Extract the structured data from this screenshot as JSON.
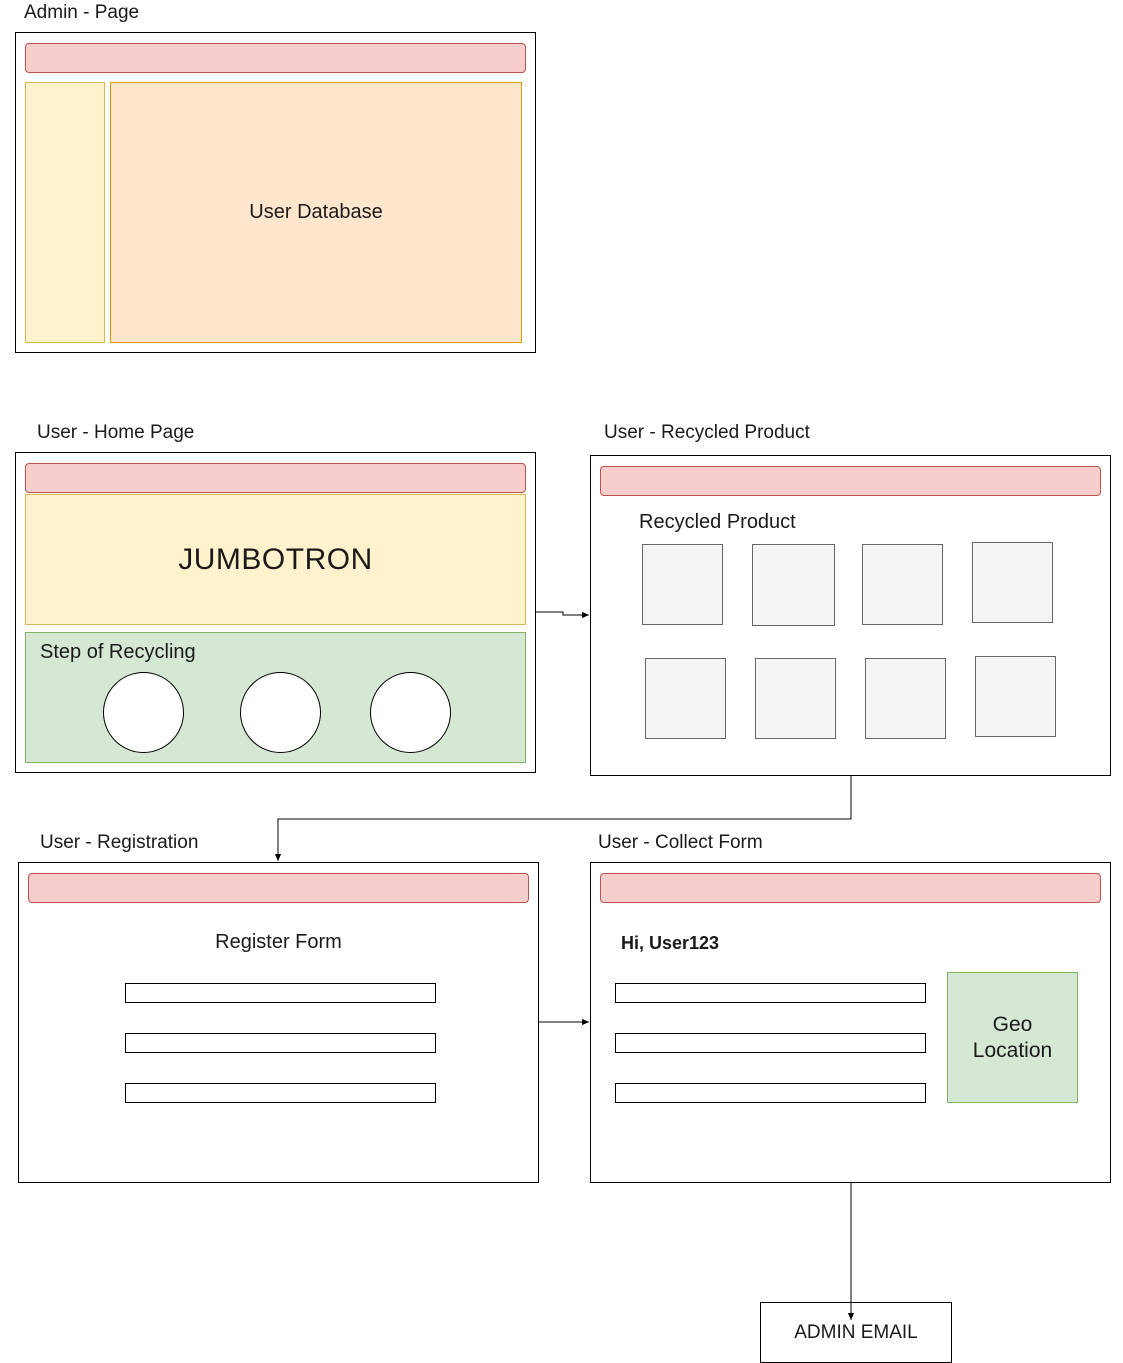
{
  "admin_page": {
    "caption": "Admin - Page",
    "content_label": "User Database"
  },
  "home_page": {
    "caption": "User - Home Page",
    "jumbotron": "JUMBOTRON",
    "steps_label": "Step of Recycling",
    "step_count": 3
  },
  "recycled_page": {
    "caption": "User - Recycled Product",
    "heading": "Recycled Product",
    "product_count": 8
  },
  "registration_page": {
    "caption": "User - Registration",
    "heading": "Register Form",
    "field_count": 3
  },
  "collect_page": {
    "caption": "User - Collect Form",
    "greeting": "Hi, User123",
    "geo_label": "Geo Location",
    "field_count": 3
  },
  "admin_email": {
    "label": "ADMIN EMAIL"
  },
  "colors": {
    "navbar_fill": "#f8cecc",
    "navbar_stroke": "#b85450",
    "yellow_fill": "#fff2cc",
    "orange_fill": "#ffe6cc",
    "green_fill": "#d5e8d4",
    "tile_fill": "#f5f5f5"
  }
}
